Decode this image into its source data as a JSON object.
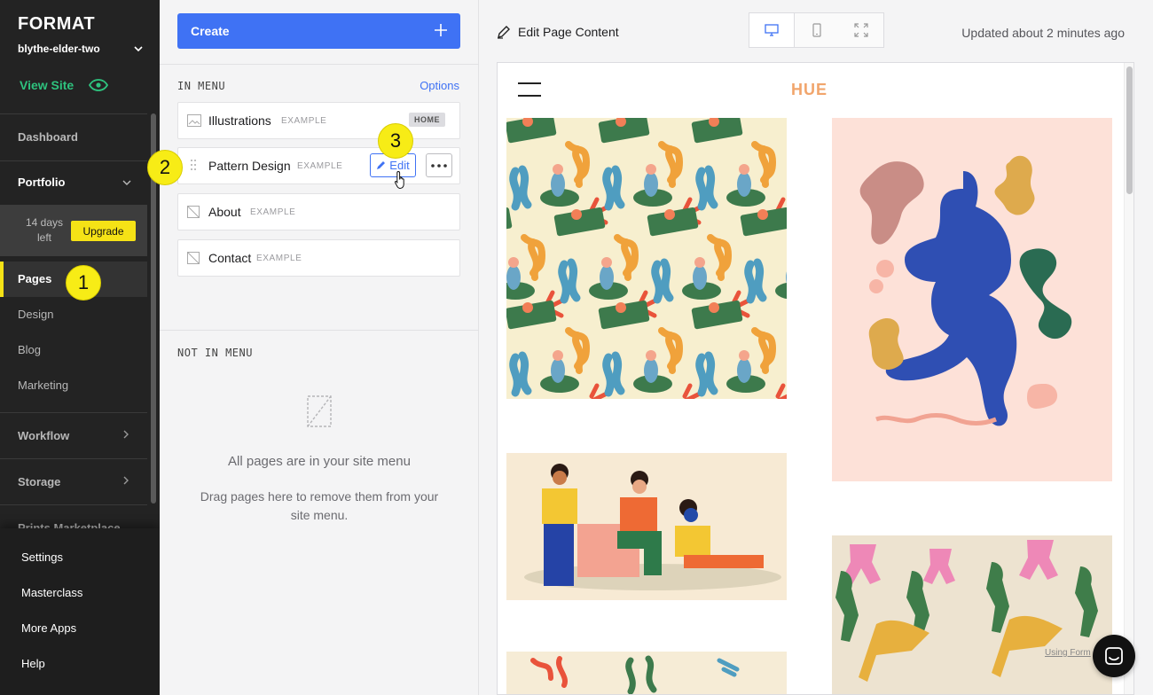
{
  "sidebar": {
    "logo": "FORMAT",
    "site_name": "blythe-elder-two",
    "view_site": "View Site",
    "dashboard": "Dashboard",
    "portfolio": "Portfolio",
    "trial_text": "14 days left",
    "upgrade": "Upgrade",
    "pages": "Pages",
    "design": "Design",
    "blog": "Blog",
    "marketing": "Marketing",
    "workflow": "Workflow",
    "storage": "Storage",
    "prints": "Prints Marketplace",
    "bottom": [
      "Settings",
      "Masterclass",
      "More Apps",
      "Help"
    ],
    "accent": "#f5e216",
    "link_color": "#2ec27e"
  },
  "badges": [
    "1",
    "2",
    "3"
  ],
  "middle": {
    "create": "Create",
    "in_menu": "IN MENU",
    "options": "Options",
    "pages": [
      {
        "name": "Illustrations",
        "tag": "EXAMPLE",
        "home": "HOME"
      },
      {
        "name": "Pattern Design",
        "tag": "EXAMPLE",
        "edit": "Edit"
      },
      {
        "name": "About",
        "tag": "EXAMPLE"
      },
      {
        "name": "Contact",
        "tag": "EXAMPLE"
      }
    ],
    "not_in_menu": "NOT IN MENU",
    "empty_title": "All pages are in your site menu",
    "empty_sub": "Drag pages here to remove them from your site menu.",
    "accent": "#3f72f4"
  },
  "preview": {
    "edit_content": "Edit Page Content",
    "updated": "Updated about 2 minutes ago",
    "site_logo": "HUE",
    "using_text": "Using Form",
    "devices": [
      "desktop-icon",
      "mobile-icon",
      "fullscreen-icon"
    ]
  }
}
